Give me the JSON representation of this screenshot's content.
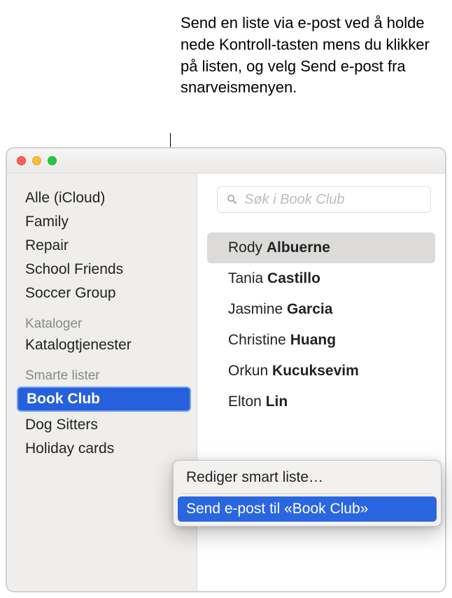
{
  "annotation": "Send en liste via e-post ved å holde nede Kontroll-tasten mens du klikker på listen, og velg Send e-post fra snarveismenyen.",
  "sidebar": {
    "groups": [
      {
        "items": [
          {
            "label": "Alle (iCloud)",
            "name": "sidebar-item-all-icloud"
          },
          {
            "label": "Family",
            "name": "sidebar-item-family"
          },
          {
            "label": "Repair",
            "name": "sidebar-item-repair"
          },
          {
            "label": "School Friends",
            "name": "sidebar-item-school-friends"
          },
          {
            "label": "Soccer Group",
            "name": "sidebar-item-soccer-group"
          }
        ]
      },
      {
        "header": "Kataloger",
        "items": [
          {
            "label": "Katalogtjenester",
            "name": "sidebar-item-directory-services"
          }
        ]
      },
      {
        "header": "Smarte lister",
        "items": [
          {
            "label": "Book Club",
            "name": "sidebar-item-book-club",
            "selected": true
          },
          {
            "label": "Dog Sitters",
            "name": "sidebar-item-dog-sitters"
          },
          {
            "label": "Holiday cards",
            "name": "sidebar-item-holiday-cards"
          }
        ]
      }
    ]
  },
  "search": {
    "placeholder": "Søk i Book Club"
  },
  "contacts": [
    {
      "first": "Rody",
      "last": "Albuerne",
      "selected": true
    },
    {
      "first": "Tania",
      "last": "Castillo"
    },
    {
      "first": "Jasmine",
      "last": "Garcia"
    },
    {
      "first": "Christine",
      "last": "Huang"
    },
    {
      "first": "Orkun",
      "last": "Kucuksevim"
    },
    {
      "first": "Elton",
      "last": "Lin"
    }
  ],
  "context_menu": {
    "items": [
      {
        "label": "Rediger smart liste…",
        "highlighted": false
      },
      {
        "label": "Send e-post til «Book Club»",
        "highlighted": true
      }
    ]
  }
}
